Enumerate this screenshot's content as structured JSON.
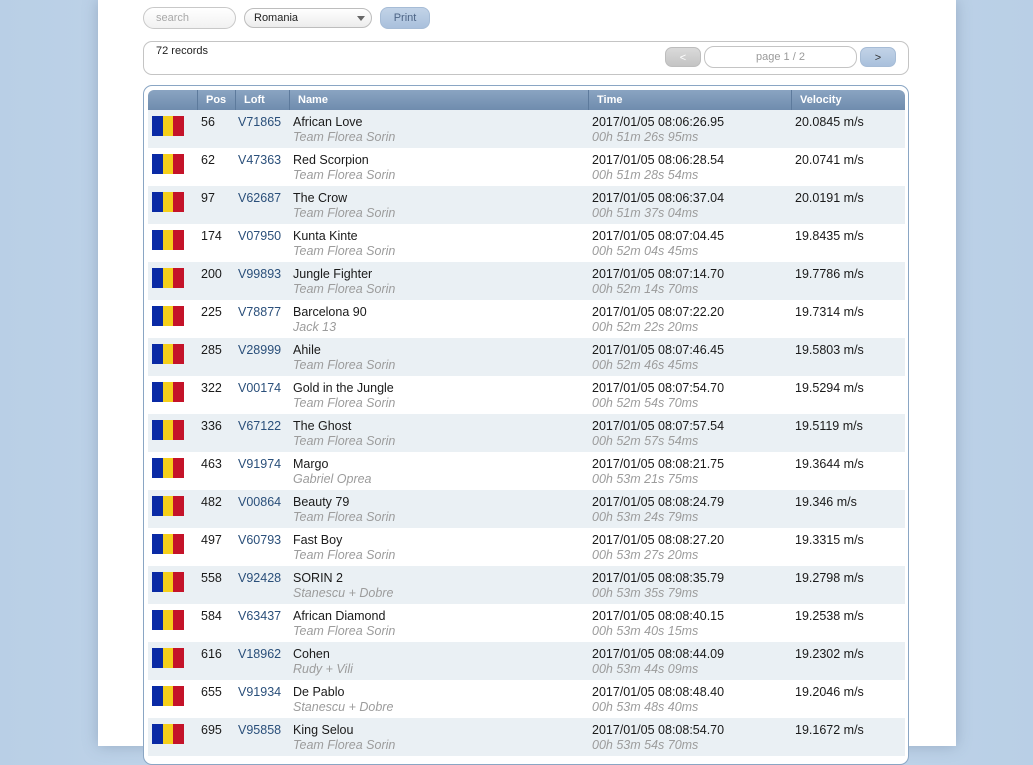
{
  "toolbar": {
    "search_placeholder": "search",
    "country_selected": "Romania",
    "print_label": "Print"
  },
  "pager": {
    "records": "72 records",
    "prev_label": "<",
    "page_label": "page 1 / 2",
    "next_label": ">"
  },
  "columns": [
    "",
    "Pos",
    "Loft",
    "Name",
    "Time",
    "Velocity"
  ],
  "flag_colors": [
    "#0a2aa5",
    "#f5cf1b",
    "#c41329"
  ],
  "rows": [
    {
      "pos": "56",
      "loft": "V71865",
      "name": "African Love",
      "team": "Team Florea Sorin",
      "time": "2017/01/05 08:06:26.95",
      "duration": "00h 51m 26s 95ms",
      "velocity": "20.0845 m/s"
    },
    {
      "pos": "62",
      "loft": "V47363",
      "name": "Red Scorpion",
      "team": "Team Florea Sorin",
      "time": "2017/01/05 08:06:28.54",
      "duration": "00h 51m 28s 54ms",
      "velocity": "20.0741 m/s"
    },
    {
      "pos": "97",
      "loft": "V62687",
      "name": "The Crow",
      "team": "Team Florea Sorin",
      "time": "2017/01/05 08:06:37.04",
      "duration": "00h 51m 37s 04ms",
      "velocity": "20.0191 m/s"
    },
    {
      "pos": "174",
      "loft": "V07950",
      "name": "Kunta Kinte",
      "team": "Team Florea Sorin",
      "time": "2017/01/05 08:07:04.45",
      "duration": "00h 52m 04s 45ms",
      "velocity": "19.8435 m/s"
    },
    {
      "pos": "200",
      "loft": "V99893",
      "name": "Jungle Fighter",
      "team": "Team Florea Sorin",
      "time": "2017/01/05 08:07:14.70",
      "duration": "00h 52m 14s 70ms",
      "velocity": "19.7786 m/s"
    },
    {
      "pos": "225",
      "loft": "V78877",
      "name": "Barcelona 90",
      "team": "Jack 13",
      "time": "2017/01/05 08:07:22.20",
      "duration": "00h 52m 22s 20ms",
      "velocity": "19.7314 m/s"
    },
    {
      "pos": "285",
      "loft": "V28999",
      "name": "Ahile",
      "team": "Team Florea Sorin",
      "time": "2017/01/05 08:07:46.45",
      "duration": "00h 52m 46s 45ms",
      "velocity": "19.5803 m/s"
    },
    {
      "pos": "322",
      "loft": "V00174",
      "name": "Gold in the Jungle",
      "team": "Team Florea Sorin",
      "time": "2017/01/05 08:07:54.70",
      "duration": "00h 52m 54s 70ms",
      "velocity": "19.5294 m/s"
    },
    {
      "pos": "336",
      "loft": "V67122",
      "name": "The Ghost",
      "team": "Team Florea Sorin",
      "time": "2017/01/05 08:07:57.54",
      "duration": "00h 52m 57s 54ms",
      "velocity": "19.5119 m/s"
    },
    {
      "pos": "463",
      "loft": "V91974",
      "name": "Margo",
      "team": "Gabriel Oprea",
      "time": "2017/01/05 08:08:21.75",
      "duration": "00h 53m 21s 75ms",
      "velocity": "19.3644 m/s"
    },
    {
      "pos": "482",
      "loft": "V00864",
      "name": "Beauty 79",
      "team": "Team Florea Sorin",
      "time": "2017/01/05 08:08:24.79",
      "duration": "00h 53m 24s 79ms",
      "velocity": "19.346 m/s"
    },
    {
      "pos": "497",
      "loft": "V60793",
      "name": "Fast Boy",
      "team": "Team Florea Sorin",
      "time": "2017/01/05 08:08:27.20",
      "duration": "00h 53m 27s 20ms",
      "velocity": "19.3315 m/s"
    },
    {
      "pos": "558",
      "loft": "V92428",
      "name": "SORIN 2",
      "team": "Stanescu + Dobre",
      "time": "2017/01/05 08:08:35.79",
      "duration": "00h 53m 35s 79ms",
      "velocity": "19.2798 m/s"
    },
    {
      "pos": "584",
      "loft": "V63437",
      "name": "African Diamond",
      "team": "Team Florea Sorin",
      "time": "2017/01/05 08:08:40.15",
      "duration": "00h 53m 40s 15ms",
      "velocity": "19.2538 m/s"
    },
    {
      "pos": "616",
      "loft": "V18962",
      "name": "Cohen",
      "team": "Rudy + Vili",
      "time": "2017/01/05 08:08:44.09",
      "duration": "00h 53m 44s 09ms",
      "velocity": "19.2302 m/s"
    },
    {
      "pos": "655",
      "loft": "V91934",
      "name": "De Pablo",
      "team": "Stanescu + Dobre",
      "time": "2017/01/05 08:08:48.40",
      "duration": "00h 53m 48s 40ms",
      "velocity": "19.2046 m/s"
    },
    {
      "pos": "695",
      "loft": "V95858",
      "name": "King Selou",
      "team": "Team Florea Sorin",
      "time": "2017/01/05 08:08:54.70",
      "duration": "00h 53m 54s 70ms",
      "velocity": "19.1672 m/s"
    }
  ]
}
